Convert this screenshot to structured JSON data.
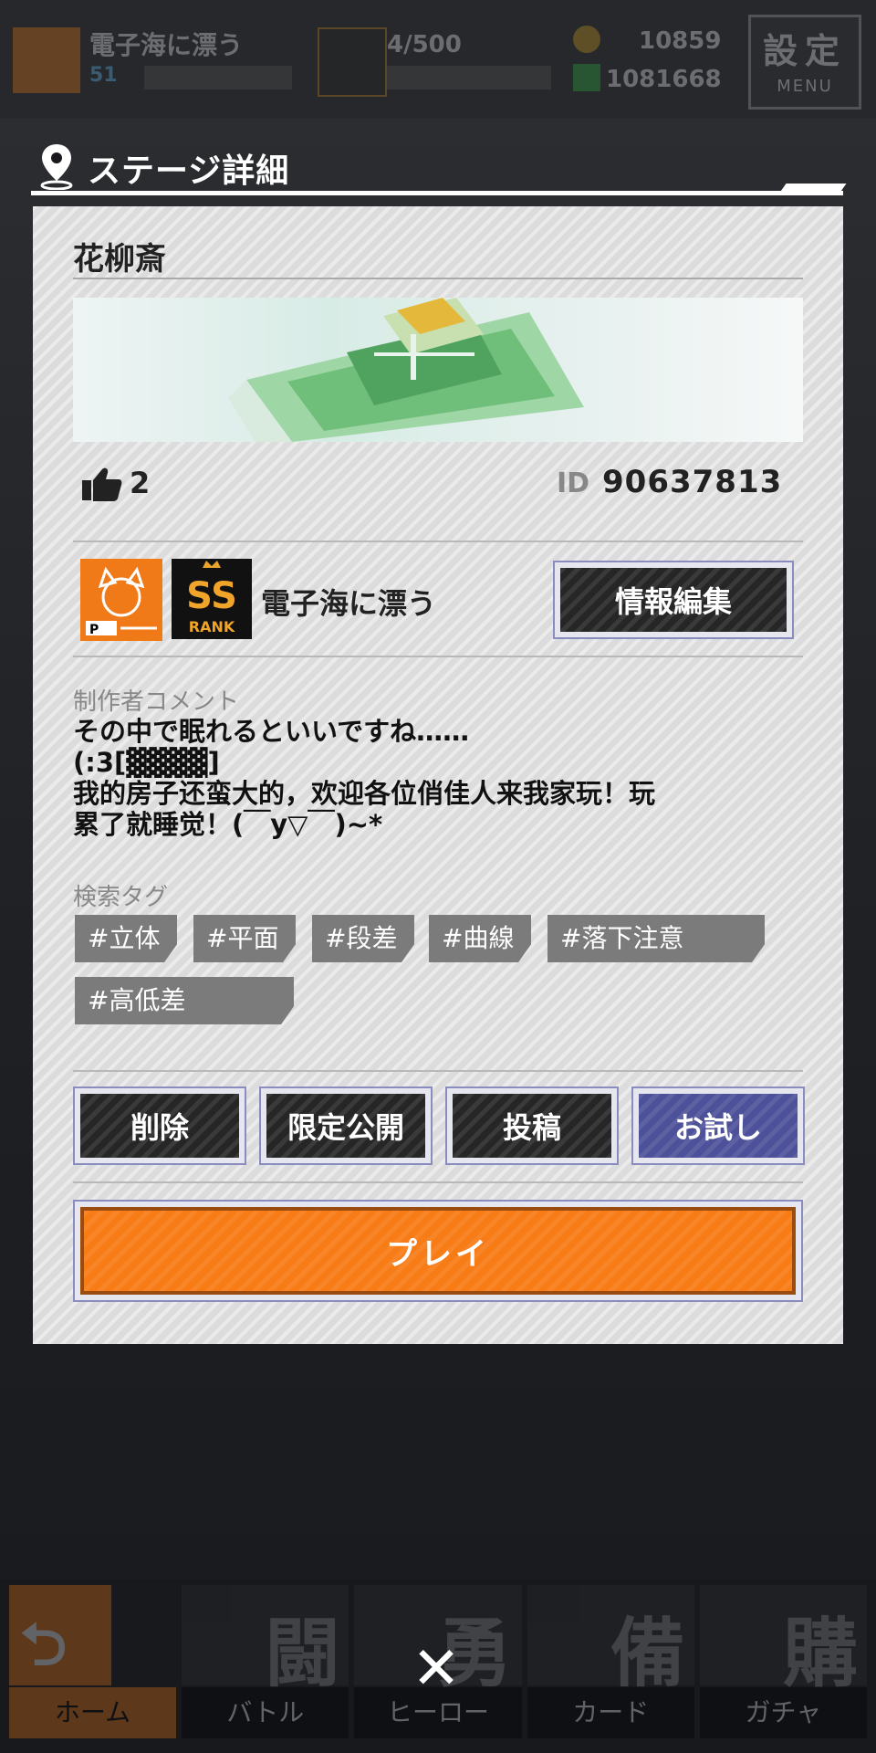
{
  "hud": {
    "player_name": "電子海に漂う",
    "level": "51",
    "rank_progress": "4/500",
    "coins": "10859",
    "gems": "1081668",
    "settings_label": "設定",
    "settings_sub": "MENU"
  },
  "modal": {
    "title": "ステージ詳細",
    "stage_name": "花柳斎",
    "likes": "2",
    "id_label": "ID",
    "id_value": "90637813",
    "creator": {
      "name": "電子海に漂う",
      "rank_label": "RANK",
      "rank_value": "SS",
      "avatar_tag": "P"
    },
    "edit_button": "情報編集",
    "comment_label": "制作者コメント",
    "comment_text": "その中で眠れるといいですね……\n(:3[▓▓▓▓]\n我的房子还蛮大的，欢迎各位俏佳人来我家玩！玩\n累了就睡觉！(￣y▽￣)~*",
    "tags_label": "検索タグ",
    "tags": [
      "#立体",
      "#平面",
      "#段差",
      "#曲線",
      "#落下注意",
      "#高低差"
    ],
    "actions": {
      "delete": "削除",
      "limited": "限定公開",
      "post": "投稿",
      "try": "お試し"
    },
    "play_button": "プレイ"
  },
  "nav": [
    {
      "label": "ホーム",
      "glyph": "⮌"
    },
    {
      "label": "バトル",
      "glyph": "闘"
    },
    {
      "label": "ヒーロー",
      "glyph": "勇"
    },
    {
      "label": "カード",
      "glyph": "備"
    },
    {
      "label": "ガチャ",
      "glyph": "購"
    }
  ],
  "colors": {
    "accent_orange": "#f77c16",
    "try_button": "#4d5199",
    "panel": "#dcdcdc"
  }
}
